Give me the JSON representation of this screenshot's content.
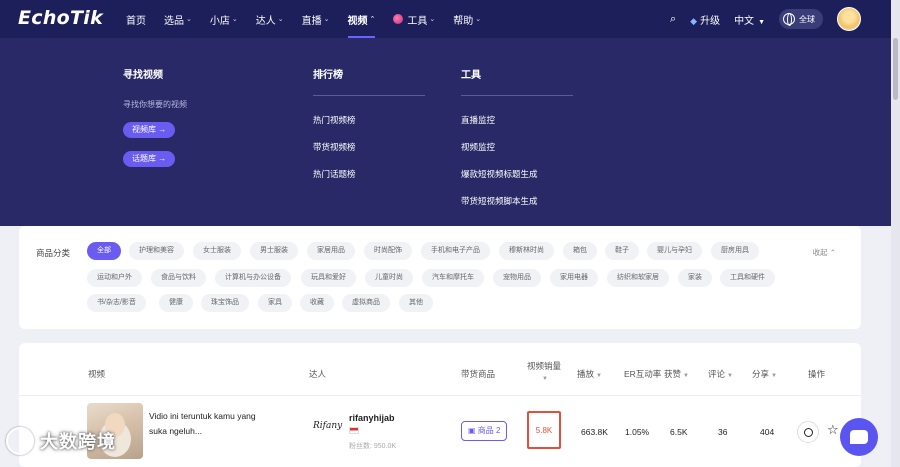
{
  "brand": {
    "logo": "EchoTik",
    "accent": "#6a5cf0",
    "nav_bg": "#1d1f5a"
  },
  "nav": {
    "items": [
      {
        "label": "首页",
        "caret": false
      },
      {
        "label": "选品",
        "caret": true
      },
      {
        "label": "小店",
        "caret": true
      },
      {
        "label": "达人",
        "caret": true
      },
      {
        "label": "直播",
        "caret": true
      },
      {
        "label": "视频",
        "caret": true,
        "active": true
      },
      {
        "label": "工具",
        "caret": true,
        "icon": "tools-dot-icon"
      },
      {
        "label": "帮助",
        "caret": true
      }
    ],
    "upgrade": "升级",
    "language": "中文",
    "region": "全球"
  },
  "dropdown": {
    "find_video": {
      "title": "寻找视频",
      "desc": "寻找你想要的视频",
      "buttons": [
        "视频库 →",
        "话题库 →"
      ]
    },
    "rankings": {
      "title": "排行榜",
      "links": [
        "热门视频榜",
        "带货视频榜",
        "热门话题榜"
      ]
    },
    "tools": {
      "title": "工具",
      "links": [
        "直播监控",
        "视频监控",
        "爆款短视频标题生成",
        "带货短视频脚本生成"
      ]
    }
  },
  "categories": {
    "label": "商品分类",
    "collapse": "收起",
    "rows": [
      [
        "全部",
        "护理和美容",
        "女士服装",
        "男士服装",
        "家居用品",
        "时尚配饰",
        "手机和电子产品",
        "穆斯林时尚",
        "箱包",
        "鞋子",
        "婴儿与孕妇",
        "厨房用具"
      ],
      [
        "运动和户外",
        "食品与饮料",
        "计算机与办公设备",
        "玩具和爱好",
        "儿童时尚",
        "汽车和摩托车",
        "宠物用品",
        "家用电器",
        "纺织和软家居",
        "家装",
        "工具和硬件"
      ],
      [
        "书/杂志/影音",
        "健康",
        "珠宝饰品",
        "家具",
        "收藏",
        "虚拟商品",
        "其他"
      ]
    ]
  },
  "table": {
    "headers": {
      "video": "视频",
      "creator": "达人",
      "goods": "带货商品",
      "video_sales_line1": "视频销量",
      "plays": "播放",
      "er": "ER互动率",
      "likes": "获赞",
      "comments": "评论",
      "shares": "分享",
      "actions": "操作"
    },
    "row": {
      "title": "Vidio ini teruntuk kamu yang suka ngeluh...",
      "creator_logo": "Rifany",
      "creator_name": "rifanyhijab",
      "fans": "粉丝数: 950.0K",
      "goods_btn": "商品 2",
      "sales": "5.8K",
      "plays": "663.8K",
      "er": "1.05%",
      "likes": "6.5K",
      "comments": "36",
      "shares": "404"
    }
  },
  "watermark": {
    "text": "大数跨境"
  }
}
